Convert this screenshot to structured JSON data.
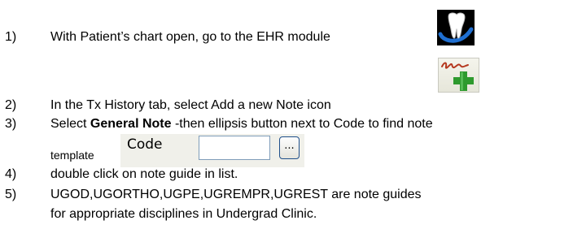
{
  "steps": [
    {
      "number": "1)",
      "text": "With Patient’s chart open, go to the EHR module"
    },
    {
      "number": "2)",
      "text": "In the Tx History tab, select Add a new Note icon"
    },
    {
      "number": "3)",
      "text_before": "Select ",
      "bold": "General Note",
      "text_after": " -then ellipsis button next to Code to find note",
      "continuation": "template"
    },
    {
      "number": "4)",
      "text": "double click on note guide in list."
    },
    {
      "number": "5)",
      "text": "UGOD,UGORTHO,UGPE,UGREMPR,UGREST are note guides",
      "continuation": "for appropriate disciplines in Undergrad Clinic."
    }
  ],
  "code_widget": {
    "label": "Code",
    "value": "",
    "button_label": "..."
  },
  "icons": {
    "ehr": "tooth-icon",
    "add_note": "add-note-icon"
  },
  "colors": {
    "tooth_bg": "#000000",
    "swoosh_blue": "#1f6fd1",
    "add_green": "#2e9a2e"
  }
}
